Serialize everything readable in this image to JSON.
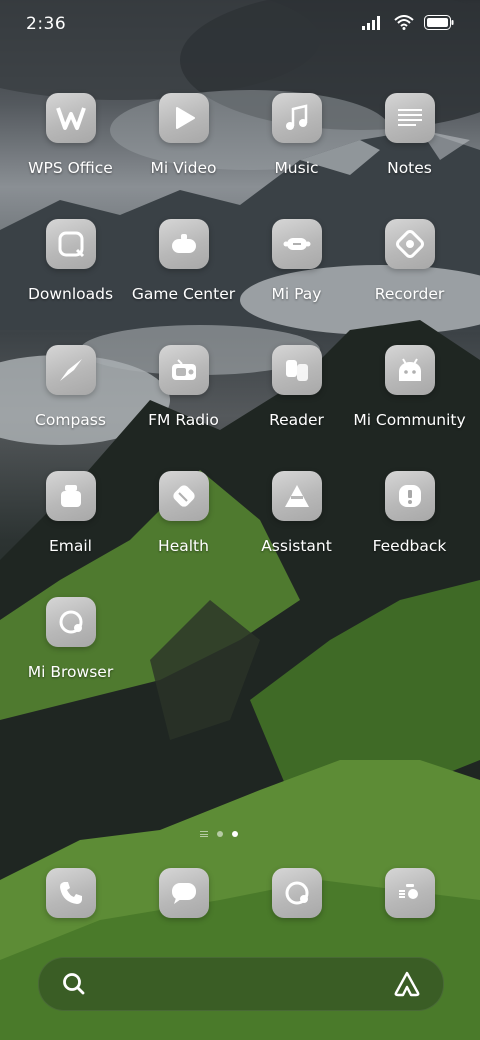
{
  "status_bar": {
    "time": "2:36",
    "signal_icon": "cellular-signal-icon",
    "wifi_icon": "wifi-icon",
    "battery_icon": "battery-icon"
  },
  "apps": [
    {
      "label": "WPS Office",
      "icon": "wps-office-icon"
    },
    {
      "label": "Mi Video",
      "icon": "play-icon"
    },
    {
      "label": "Music",
      "icon": "music-note-icon"
    },
    {
      "label": "Notes",
      "icon": "notes-icon"
    },
    {
      "label": "Downloads",
      "icon": "downloads-icon"
    },
    {
      "label": "Game Center",
      "icon": "gamepad-icon"
    },
    {
      "label": "Mi Pay",
      "icon": "mi-pay-icon"
    },
    {
      "label": "Recorder",
      "icon": "recorder-icon"
    },
    {
      "label": "Compass",
      "icon": "compass-icon"
    },
    {
      "label": "FM Radio",
      "icon": "radio-icon"
    },
    {
      "label": "Reader",
      "icon": "reader-icon"
    },
    {
      "label": "Mi Community",
      "icon": "android-icon"
    },
    {
      "label": "Email",
      "icon": "email-icon"
    },
    {
      "label": "Health",
      "icon": "health-icon"
    },
    {
      "label": "Assistant",
      "icon": "assistant-icon"
    },
    {
      "label": "Feedback",
      "icon": "feedback-icon"
    },
    {
      "label": "Mi Browser",
      "icon": "browser-icon"
    }
  ],
  "page_indicator": {
    "pages": 3,
    "current": 3
  },
  "dock": [
    {
      "icon": "phone-icon"
    },
    {
      "icon": "messages-icon"
    },
    {
      "icon": "browser-icon"
    },
    {
      "icon": "camera-icon"
    }
  ],
  "search_bar": {
    "left_icon": "search-icon",
    "right_icon": "assistant-icon"
  }
}
